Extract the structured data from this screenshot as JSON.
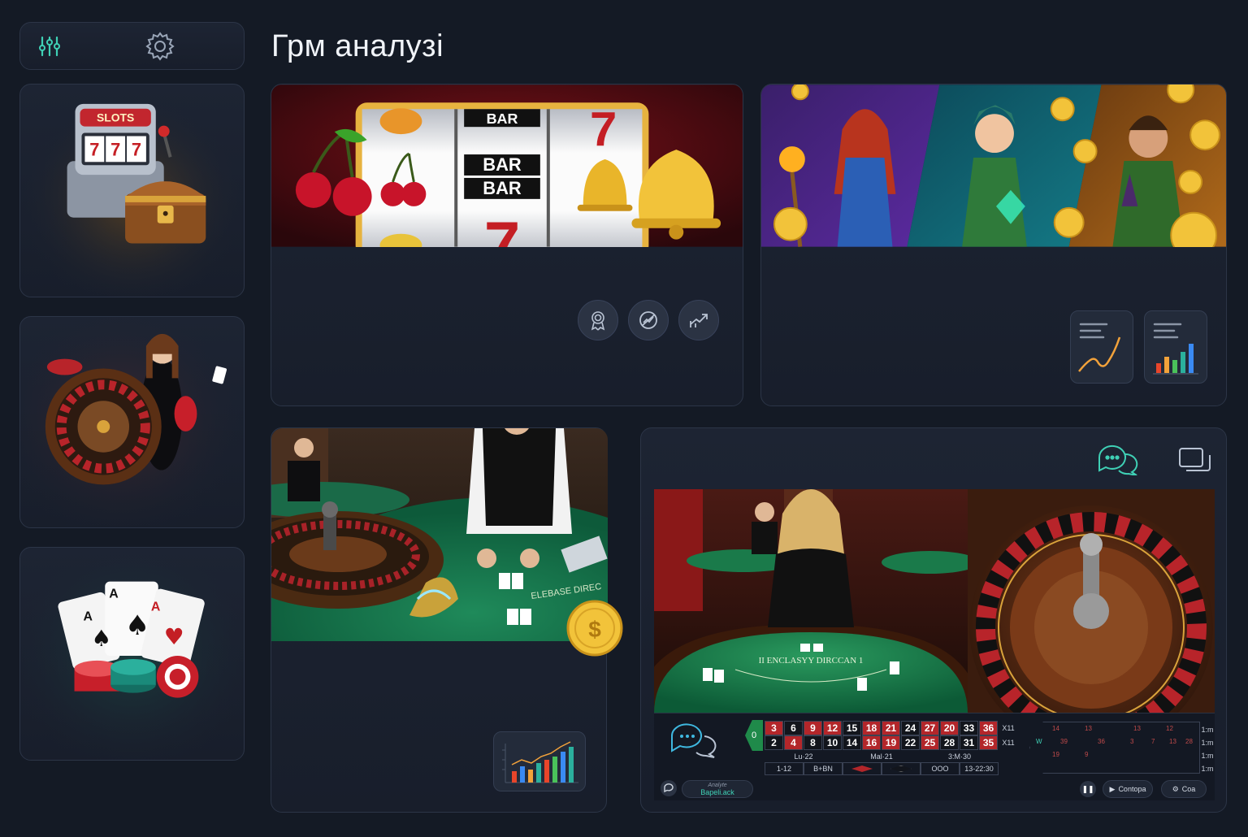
{
  "page": {
    "title": "Грм аналузі"
  },
  "toolbar": {
    "filter_icon": "sliders-icon",
    "settings_icon": "gear-icon"
  },
  "sidebar": {
    "cards": [
      {
        "id": "slots",
        "sign": "SLOTS",
        "reels": "777"
      },
      {
        "id": "roulette"
      },
      {
        "id": "cards"
      }
    ]
  },
  "slots_panel": {
    "reel_labels": [
      "BAR",
      "BAR",
      "BAR",
      "BAR"
    ],
    "icons": [
      "award-icon",
      "no-chart-icon",
      "trend-up-icon"
    ]
  },
  "heroes_panel": {
    "tiles": [
      "line-chart-tile",
      "bar-chart-tile"
    ]
  },
  "blackjack_panel": {
    "table_text": "ELEBASE DIREC",
    "tile": "bar-chart-tile"
  },
  "live_panel": {
    "top_icons": [
      "chat-icon",
      "windows-icon"
    ],
    "table_text": "II ENCLASYY DIRCCAN 1",
    "board": {
      "zero": "0",
      "row1": [
        "3",
        "6",
        "9",
        "12",
        "15",
        "18",
        "21",
        "24",
        "27",
        "20",
        "33",
        "36"
      ],
      "row2": [
        "2",
        "4",
        "8",
        "10",
        "14",
        "16",
        "19",
        "22",
        "25",
        "28",
        "31",
        "35"
      ],
      "row1_colors": [
        "red",
        "black",
        "red",
        "red",
        "black",
        "red",
        "red",
        "black",
        "red",
        "red",
        "black",
        "red"
      ],
      "row2_colors": [
        "black",
        "red",
        "black",
        "black",
        "black",
        "red",
        "red",
        "black",
        "red",
        "black",
        "black",
        "red"
      ],
      "side_labels": [
        "X11",
        "X11"
      ],
      "dozens": [
        "Lu·22",
        "Mal·21",
        "3:M·30"
      ],
      "bets": [
        "1-12",
        "B+BN",
        "",
        "",
        "OOO",
        "13-22:30"
      ],
      "race_numbers": [
        "14",
        "13",
        "13",
        "12",
        "39",
        "36",
        "3",
        "7",
        "13",
        "28",
        "19",
        "9"
      ],
      "race_side": [
        "1:m",
        "1:m",
        "1:m",
        "1:m"
      ],
      "race_w": "W"
    },
    "bottom": {
      "caption_small": "Analyte",
      "caption": "Bapeli.ack",
      "buttons": [
        "Contopa",
        "Coa"
      ]
    }
  }
}
